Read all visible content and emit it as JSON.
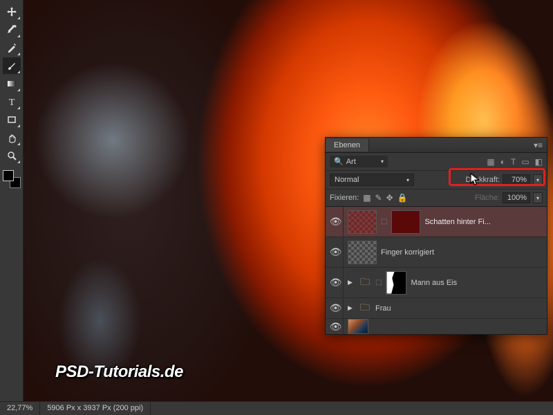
{
  "status": {
    "zoom": "22,77%",
    "doc_dims": "5906 Px x 3937 Px (200 ppi)"
  },
  "watermark": "PSD-Tutorials.de",
  "panel": {
    "title": "Ebenen",
    "filter_label": "Art",
    "blend_mode": "Normal",
    "opacity_label": "Deckkraft:",
    "opacity_value": "70%",
    "fill_label": "Fläche:",
    "fill_value": "100%",
    "lock_label": "Fixieren:"
  },
  "layers": [
    {
      "name": "Schatten hinter Fi..."
    },
    {
      "name": "Finger korrigiert"
    },
    {
      "name": "Mann aus Eis"
    },
    {
      "name": "Frau"
    }
  ]
}
